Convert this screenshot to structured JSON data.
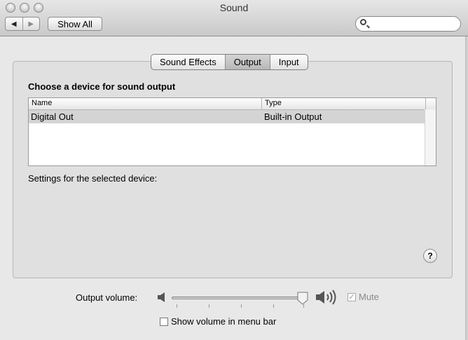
{
  "window": {
    "title": "Sound"
  },
  "toolbar": {
    "back_glyph": "◀",
    "forward_glyph": "▶",
    "show_all": "Show All",
    "search_icon": "magnifier-icon"
  },
  "tabs": [
    {
      "label": "Sound Effects",
      "selected": false
    },
    {
      "label": "Output",
      "selected": true
    },
    {
      "label": "Input",
      "selected": false
    }
  ],
  "output": {
    "heading": "Choose a device for sound output",
    "columns": {
      "name": "Name",
      "type": "Type"
    },
    "rows": [
      {
        "name": "Digital Out",
        "type": "Built-in Output",
        "selected": true
      }
    ],
    "settings_label": "Settings for the selected device:"
  },
  "help": {
    "glyph": "?"
  },
  "volume": {
    "label": "Output volume:",
    "level": 0.96,
    "mute_label": "Mute",
    "mute_checked": true,
    "show_in_menu_bar_label": "Show volume in menu bar",
    "show_in_menu_bar_checked": false
  }
}
